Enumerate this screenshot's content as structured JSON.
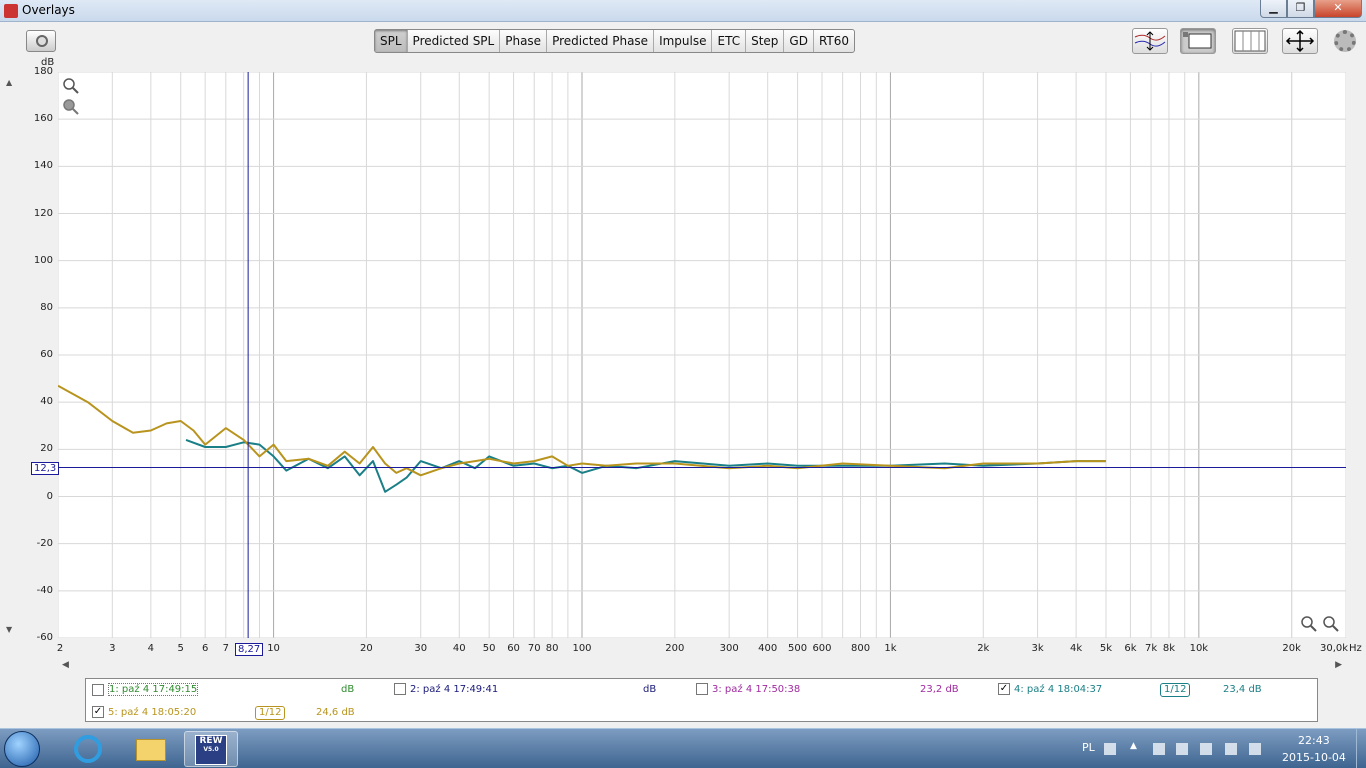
{
  "window": {
    "title": "Overlays",
    "minimize": "▁",
    "maximize": "❐",
    "close": "✕"
  },
  "toolbar": {
    "tabs": [
      "SPL",
      "Predicted SPL",
      "Phase",
      "Predicted Phase",
      "Impulse",
      "ETC",
      "Step",
      "GD",
      "RT60"
    ],
    "active_tab": "SPL"
  },
  "axis": {
    "y_unit": "dB",
    "x_unit": "Hz",
    "y_ticks": [
      "180",
      "160",
      "140",
      "120",
      "100",
      "80",
      "60",
      "40",
      "20",
      "0",
      "-20",
      "-40",
      "-60"
    ],
    "x_ticks": [
      "2",
      "3",
      "4",
      "5",
      "6",
      "7",
      "10",
      "20",
      "30",
      "40",
      "50",
      "60",
      "70",
      "80",
      "100",
      "200",
      "300",
      "400",
      "500",
      "600",
      "800",
      "1k",
      "2k",
      "3k",
      "4k",
      "5k",
      "6k",
      "7k",
      "8k",
      "10k",
      "20k",
      "30,0k"
    ],
    "cursor_x_label": "8,27",
    "cursor_y_label": "12,3"
  },
  "chart_data": {
    "type": "line",
    "title": "",
    "xlabel": "Hz",
    "ylabel": "dB",
    "xscale": "log",
    "xlim": [
      2,
      30000
    ],
    "ylim": [
      -60,
      180
    ],
    "grid": true,
    "cursor": {
      "x": 8.27,
      "y": 12.3
    },
    "series": [
      {
        "name": "4: paź 4 18:04:37",
        "color": "#1a7f86",
        "x": [
          5.2,
          6,
          7,
          8,
          9,
          10,
          11,
          13,
          15,
          17,
          19,
          21,
          23,
          25,
          27,
          30,
          35,
          40,
          45,
          50,
          60,
          70,
          80,
          90,
          100,
          120,
          150,
          200,
          300,
          400,
          500,
          700,
          1000,
          1500,
          2000,
          3000,
          4000,
          5000
        ],
        "y": [
          24,
          21,
          21,
          23,
          22,
          17,
          11,
          16,
          12,
          17,
          9,
          15,
          2,
          5,
          8,
          15,
          12,
          15,
          12,
          17,
          13,
          14,
          12,
          13,
          10,
          13,
          12,
          15,
          13,
          14,
          13,
          13,
          13,
          14,
          13,
          14,
          15,
          15
        ]
      },
      {
        "name": "5: paź 4 18:05:20",
        "color": "#b8941e",
        "x": [
          2,
          2.5,
          3,
          3.5,
          4,
          4.5,
          5,
          5.5,
          6,
          7,
          8,
          9,
          10,
          11,
          13,
          15,
          17,
          19,
          21,
          23,
          25,
          27,
          30,
          35,
          40,
          45,
          50,
          60,
          70,
          80,
          90,
          100,
          120,
          150,
          200,
          300,
          400,
          500,
          700,
          1000,
          1500,
          2000,
          3000,
          4000,
          5000
        ],
        "y": [
          47,
          40,
          32,
          27,
          28,
          31,
          32,
          28,
          22,
          29,
          24,
          17,
          22,
          15,
          16,
          13,
          19,
          14,
          21,
          14,
          10,
          12,
          9,
          12,
          14,
          15,
          16,
          14,
          15,
          17,
          13,
          14,
          13,
          14,
          14,
          12,
          13,
          12,
          14,
          13,
          12,
          14,
          14,
          15,
          15
        ]
      }
    ]
  },
  "legend": {
    "items": [
      {
        "label": "1: paź 4 17:49:15",
        "checked": false,
        "db": "dB",
        "color": "#2e8b2e"
      },
      {
        "label": "2: paź 4 17:49:41",
        "checked": false,
        "db": "dB",
        "color": "#1a1a7a"
      },
      {
        "label": "3: paź 4 17:50:38",
        "checked": false,
        "db": "23,2 dB",
        "color": "#a02aa0"
      },
      {
        "label": "4: paź 4 18:04:37",
        "checked": true,
        "db": "23,4 dB",
        "color": "#1a7f86",
        "smoothing": "1/12"
      },
      {
        "label": "5: paź 4 18:05:20",
        "checked": true,
        "db": "24,6 dB",
        "color": "#b8941e",
        "smoothing": "1/12"
      }
    ]
  },
  "taskbar": {
    "language": "PL",
    "time": "22:43",
    "date": "2015-10-04",
    "rew_label": "REW",
    "rew_version": "V5.0"
  }
}
